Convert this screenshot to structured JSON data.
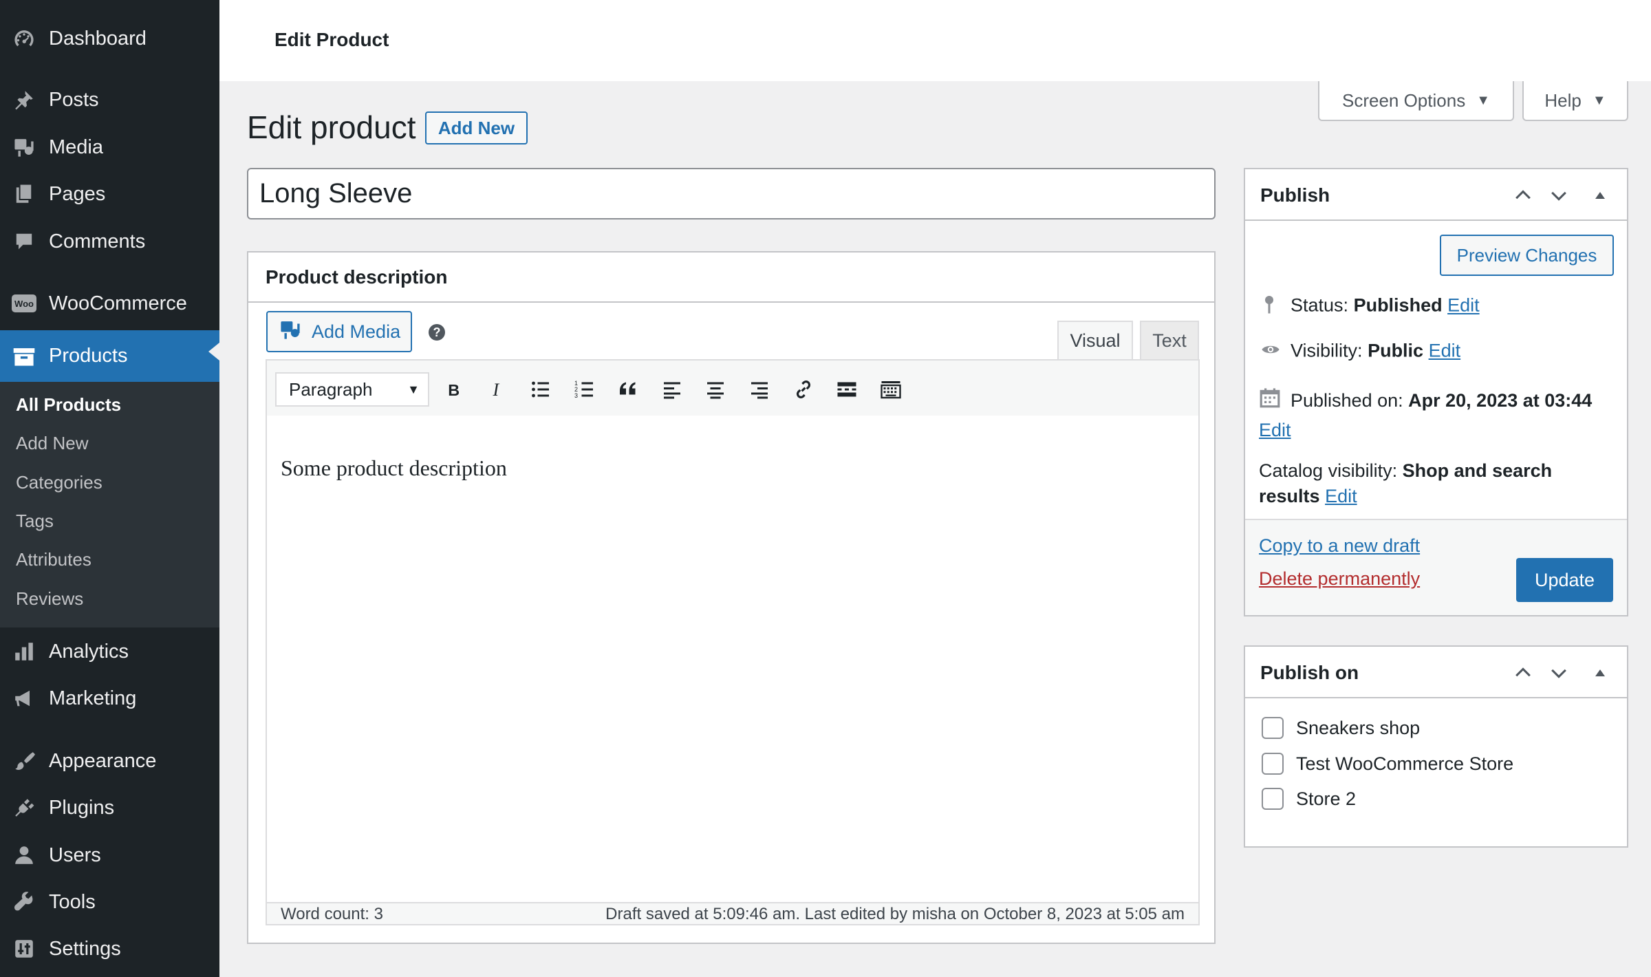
{
  "sidebar": {
    "menu": {
      "dashboard": "Dashboard",
      "posts": "Posts",
      "media": "Media",
      "pages": "Pages",
      "comments": "Comments",
      "woocommerce": "WooCommerce",
      "products": "Products",
      "analytics": "Analytics",
      "marketing": "Marketing",
      "appearance": "Appearance",
      "plugins": "Plugins",
      "users": "Users",
      "tools": "Tools",
      "settings": "Settings"
    },
    "woo_logo_text": "Woo",
    "submenu": [
      "All Products",
      "Add New",
      "Categories",
      "Tags",
      "Attributes",
      "Reviews"
    ],
    "accent_color": "#2271b1"
  },
  "topbar": {
    "title": "Edit Product"
  },
  "screen_options": {
    "label": "Screen Options",
    "caret": "▼"
  },
  "help": {
    "label": "Help",
    "caret": "▼"
  },
  "page": {
    "heading": "Edit product",
    "add_new": "Add New",
    "title_value": "Long Sleeve"
  },
  "editor": {
    "section_title": "Product description",
    "add_media": "Add Media",
    "help_glyph": "?",
    "tabs": {
      "visual": "Visual",
      "text": "Text"
    },
    "format_value": "Paragraph",
    "toolbar_icons": [
      "bold-icon",
      "italic-icon",
      "bullet-list-icon",
      "numbered-list-icon",
      "blockquote-icon",
      "align-left-icon",
      "align-center-icon",
      "align-right-icon",
      "link-icon",
      "read-more-icon",
      "toolbar-toggle-icon"
    ],
    "content": "Some product description",
    "word_count": "Word count: 3",
    "draft_saved": "Draft saved at 5:09:46 am. Last edited by misha on October 8, 2023 at 5:05 am"
  },
  "publish": {
    "title": "Publish",
    "preview": "Preview Changes",
    "status_label": "Status:",
    "status_value": "Published",
    "visibility_label": "Visibility:",
    "visibility_value": "Public",
    "published_on_label": "Published on:",
    "published_on_value": "Apr 20, 2023 at 03:44",
    "catalog_label": "Catalog visibility:",
    "catalog_value": "Shop and search results",
    "edit": "Edit",
    "copy_draft": "Copy to a new draft",
    "delete": "Delete permanently",
    "update": "Update"
  },
  "publish_on": {
    "title": "Publish on",
    "stores": [
      "Sneakers shop",
      "Test WooCommerce Store",
      "Store 2"
    ]
  }
}
